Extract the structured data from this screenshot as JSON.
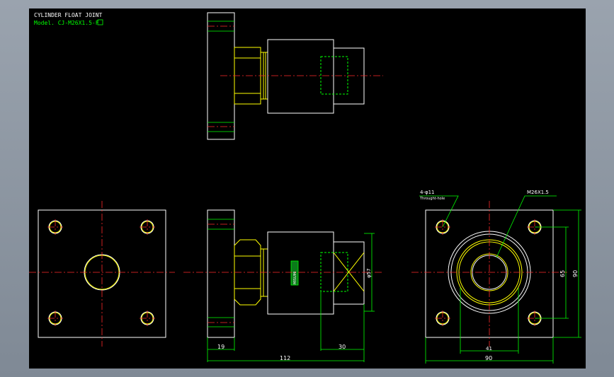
{
  "title_block": {
    "title": "CYLINDER FLOAT JOINT",
    "model": "Model. CJ-M26X1.5-F"
  },
  "annotations": {
    "holes_note": "4-φ11",
    "holes_note_sub": "Throught-hole",
    "thread_note": "M26X1.5",
    "label_plate": "MISUMI"
  },
  "dimensions": {
    "flange": "19",
    "socket": "30",
    "overall_length": "112",
    "diameter": "φ57",
    "hole_pitch": "65",
    "side_height": "90",
    "inner_width": "41",
    "side_width": "90"
  },
  "colors": {
    "outline": "#ffffff",
    "thread": "#ffff00",
    "dimension": "#00ff00",
    "centerline": "#ff2a2a",
    "background": "#000000"
  }
}
